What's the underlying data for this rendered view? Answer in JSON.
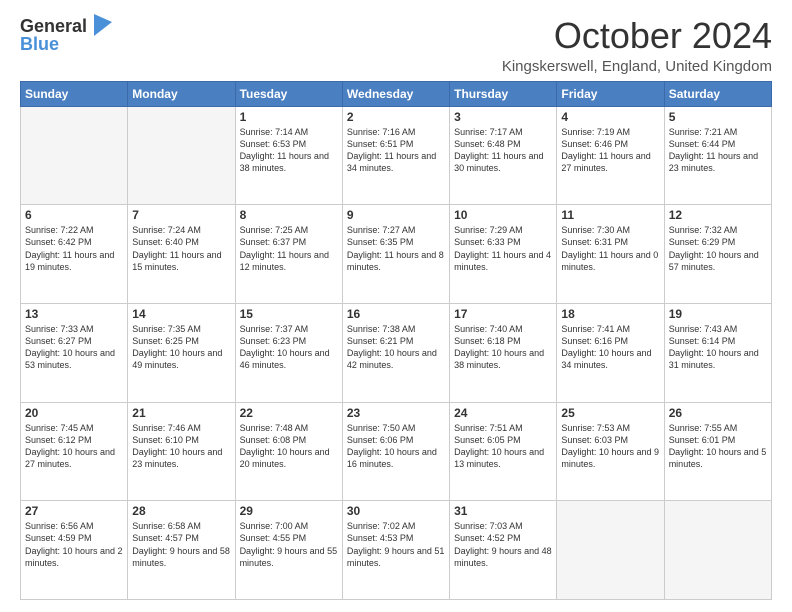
{
  "header": {
    "logo_line1": "General",
    "logo_line2": "Blue",
    "month_title": "October 2024",
    "location": "Kingskerswell, England, United Kingdom"
  },
  "weekdays": [
    "Sunday",
    "Monday",
    "Tuesday",
    "Wednesday",
    "Thursday",
    "Friday",
    "Saturday"
  ],
  "weeks": [
    [
      {
        "day": "",
        "sunrise": "",
        "sunset": "",
        "daylight": ""
      },
      {
        "day": "",
        "sunrise": "",
        "sunset": "",
        "daylight": ""
      },
      {
        "day": "1",
        "sunrise": "Sunrise: 7:14 AM",
        "sunset": "Sunset: 6:53 PM",
        "daylight": "Daylight: 11 hours and 38 minutes."
      },
      {
        "day": "2",
        "sunrise": "Sunrise: 7:16 AM",
        "sunset": "Sunset: 6:51 PM",
        "daylight": "Daylight: 11 hours and 34 minutes."
      },
      {
        "day": "3",
        "sunrise": "Sunrise: 7:17 AM",
        "sunset": "Sunset: 6:48 PM",
        "daylight": "Daylight: 11 hours and 30 minutes."
      },
      {
        "day": "4",
        "sunrise": "Sunrise: 7:19 AM",
        "sunset": "Sunset: 6:46 PM",
        "daylight": "Daylight: 11 hours and 27 minutes."
      },
      {
        "day": "5",
        "sunrise": "Sunrise: 7:21 AM",
        "sunset": "Sunset: 6:44 PM",
        "daylight": "Daylight: 11 hours and 23 minutes."
      }
    ],
    [
      {
        "day": "6",
        "sunrise": "Sunrise: 7:22 AM",
        "sunset": "Sunset: 6:42 PM",
        "daylight": "Daylight: 11 hours and 19 minutes."
      },
      {
        "day": "7",
        "sunrise": "Sunrise: 7:24 AM",
        "sunset": "Sunset: 6:40 PM",
        "daylight": "Daylight: 11 hours and 15 minutes."
      },
      {
        "day": "8",
        "sunrise": "Sunrise: 7:25 AM",
        "sunset": "Sunset: 6:37 PM",
        "daylight": "Daylight: 11 hours and 12 minutes."
      },
      {
        "day": "9",
        "sunrise": "Sunrise: 7:27 AM",
        "sunset": "Sunset: 6:35 PM",
        "daylight": "Daylight: 11 hours and 8 minutes."
      },
      {
        "day": "10",
        "sunrise": "Sunrise: 7:29 AM",
        "sunset": "Sunset: 6:33 PM",
        "daylight": "Daylight: 11 hours and 4 minutes."
      },
      {
        "day": "11",
        "sunrise": "Sunrise: 7:30 AM",
        "sunset": "Sunset: 6:31 PM",
        "daylight": "Daylight: 11 hours and 0 minutes."
      },
      {
        "day": "12",
        "sunrise": "Sunrise: 7:32 AM",
        "sunset": "Sunset: 6:29 PM",
        "daylight": "Daylight: 10 hours and 57 minutes."
      }
    ],
    [
      {
        "day": "13",
        "sunrise": "Sunrise: 7:33 AM",
        "sunset": "Sunset: 6:27 PM",
        "daylight": "Daylight: 10 hours and 53 minutes."
      },
      {
        "day": "14",
        "sunrise": "Sunrise: 7:35 AM",
        "sunset": "Sunset: 6:25 PM",
        "daylight": "Daylight: 10 hours and 49 minutes."
      },
      {
        "day": "15",
        "sunrise": "Sunrise: 7:37 AM",
        "sunset": "Sunset: 6:23 PM",
        "daylight": "Daylight: 10 hours and 46 minutes."
      },
      {
        "day": "16",
        "sunrise": "Sunrise: 7:38 AM",
        "sunset": "Sunset: 6:21 PM",
        "daylight": "Daylight: 10 hours and 42 minutes."
      },
      {
        "day": "17",
        "sunrise": "Sunrise: 7:40 AM",
        "sunset": "Sunset: 6:18 PM",
        "daylight": "Daylight: 10 hours and 38 minutes."
      },
      {
        "day": "18",
        "sunrise": "Sunrise: 7:41 AM",
        "sunset": "Sunset: 6:16 PM",
        "daylight": "Daylight: 10 hours and 34 minutes."
      },
      {
        "day": "19",
        "sunrise": "Sunrise: 7:43 AM",
        "sunset": "Sunset: 6:14 PM",
        "daylight": "Daylight: 10 hours and 31 minutes."
      }
    ],
    [
      {
        "day": "20",
        "sunrise": "Sunrise: 7:45 AM",
        "sunset": "Sunset: 6:12 PM",
        "daylight": "Daylight: 10 hours and 27 minutes."
      },
      {
        "day": "21",
        "sunrise": "Sunrise: 7:46 AM",
        "sunset": "Sunset: 6:10 PM",
        "daylight": "Daylight: 10 hours and 23 minutes."
      },
      {
        "day": "22",
        "sunrise": "Sunrise: 7:48 AM",
        "sunset": "Sunset: 6:08 PM",
        "daylight": "Daylight: 10 hours and 20 minutes."
      },
      {
        "day": "23",
        "sunrise": "Sunrise: 7:50 AM",
        "sunset": "Sunset: 6:06 PM",
        "daylight": "Daylight: 10 hours and 16 minutes."
      },
      {
        "day": "24",
        "sunrise": "Sunrise: 7:51 AM",
        "sunset": "Sunset: 6:05 PM",
        "daylight": "Daylight: 10 hours and 13 minutes."
      },
      {
        "day": "25",
        "sunrise": "Sunrise: 7:53 AM",
        "sunset": "Sunset: 6:03 PM",
        "daylight": "Daylight: 10 hours and 9 minutes."
      },
      {
        "day": "26",
        "sunrise": "Sunrise: 7:55 AM",
        "sunset": "Sunset: 6:01 PM",
        "daylight": "Daylight: 10 hours and 5 minutes."
      }
    ],
    [
      {
        "day": "27",
        "sunrise": "Sunrise: 6:56 AM",
        "sunset": "Sunset: 4:59 PM",
        "daylight": "Daylight: 10 hours and 2 minutes."
      },
      {
        "day": "28",
        "sunrise": "Sunrise: 6:58 AM",
        "sunset": "Sunset: 4:57 PM",
        "daylight": "Daylight: 9 hours and 58 minutes."
      },
      {
        "day": "29",
        "sunrise": "Sunrise: 7:00 AM",
        "sunset": "Sunset: 4:55 PM",
        "daylight": "Daylight: 9 hours and 55 minutes."
      },
      {
        "day": "30",
        "sunrise": "Sunrise: 7:02 AM",
        "sunset": "Sunset: 4:53 PM",
        "daylight": "Daylight: 9 hours and 51 minutes."
      },
      {
        "day": "31",
        "sunrise": "Sunrise: 7:03 AM",
        "sunset": "Sunset: 4:52 PM",
        "daylight": "Daylight: 9 hours and 48 minutes."
      },
      {
        "day": "",
        "sunrise": "",
        "sunset": "",
        "daylight": ""
      },
      {
        "day": "",
        "sunrise": "",
        "sunset": "",
        "daylight": ""
      }
    ]
  ]
}
